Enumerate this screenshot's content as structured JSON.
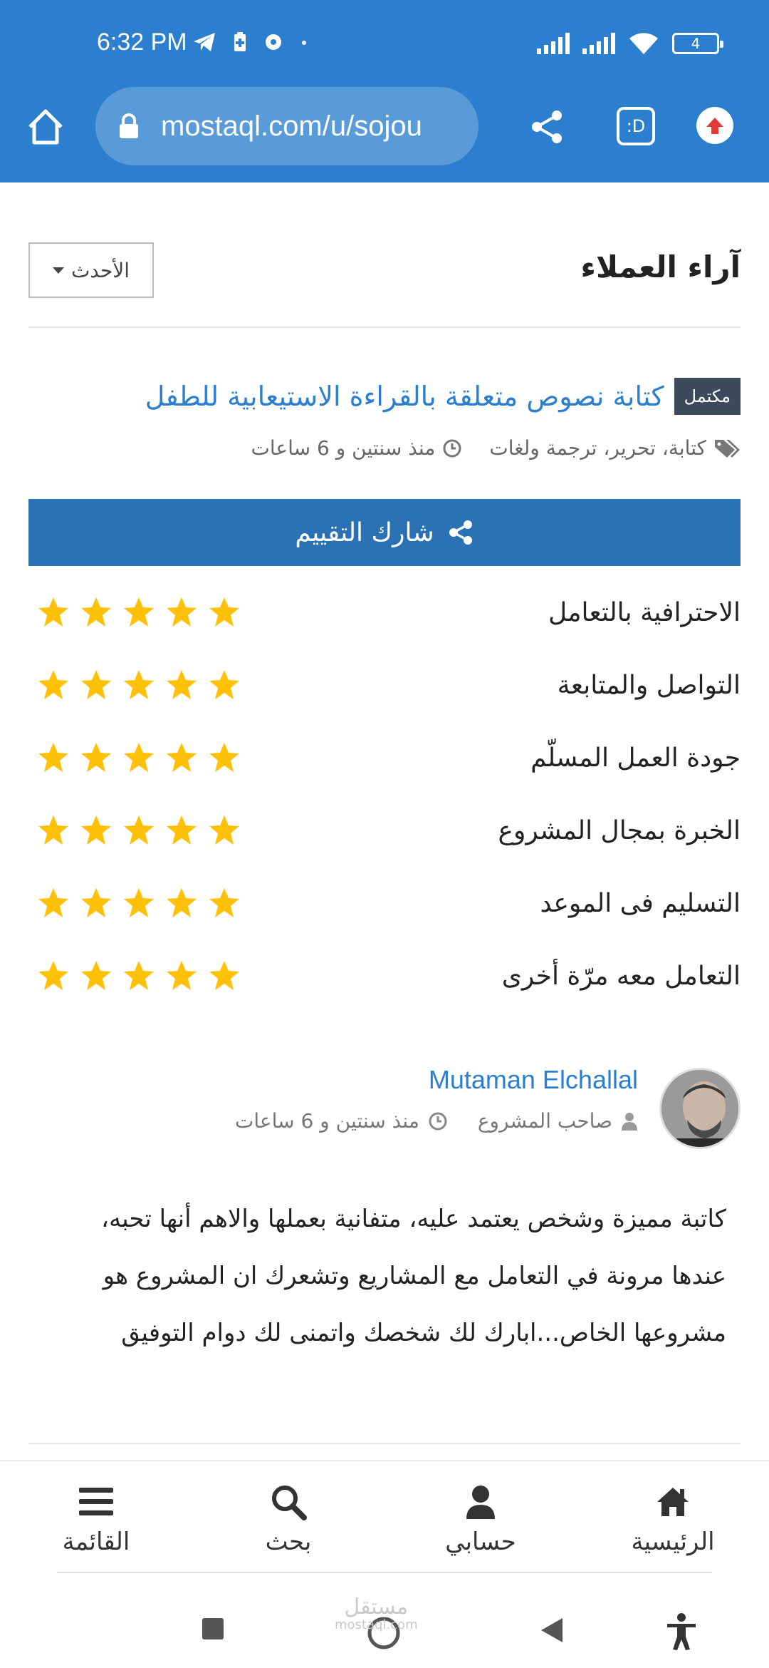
{
  "status_bar": {
    "time": "6:32 PM",
    "battery": "4"
  },
  "browser": {
    "url": "mostaql.com/u/sojou",
    "tab_badge": ":D"
  },
  "section": {
    "title": "آراء العملاء",
    "sort_label": "الأحدث"
  },
  "project": {
    "badge": "مكتمل",
    "title": "كتابة نصوص متعلقة بالقراءة الاستيعابية للطفل",
    "tags": "كتابة، تحرير، ترجمة ولغات",
    "time": "منذ سنتين و 6 ساعات"
  },
  "share_rating_label": "شارك التقييم",
  "ratings": [
    {
      "label": "الاحترافية بالتعامل",
      "stars": 5
    },
    {
      "label": "التواصل والمتابعة",
      "stars": 5
    },
    {
      "label": "جودة العمل المسلّم",
      "stars": 5
    },
    {
      "label": "الخبرة بمجال المشروع",
      "stars": 5
    },
    {
      "label": "التسليم فى الموعد",
      "stars": 5
    },
    {
      "label": "التعامل معه مرّة أخرى",
      "stars": 5
    }
  ],
  "review": {
    "name": "Mutaman Elchallal",
    "role": "صاحب المشروع",
    "time": "منذ سنتين و 6 ساعات",
    "text": "كاتبة مميزة وشخص يعتمد عليه، متفانية بعملها والاهم أنها تحبه، عندها مرونة في التعامل مع المشاريع وتشعرك ان المشروع هو مشروعها الخاص...ابارك لك شخصك واتمنى لك دوام التوفيق"
  },
  "bottom_nav": {
    "home": "الرئيسية",
    "account": "حسابي",
    "search": "بحث",
    "menu": "القائمة"
  },
  "watermark": "مستقل",
  "watermark_sub": "mostaql.com",
  "colors": {
    "brand_blue": "#2b7fce",
    "button_blue": "#2b72b4",
    "star_yellow": "#ffc107",
    "badge_dark": "#3b4b5b"
  }
}
